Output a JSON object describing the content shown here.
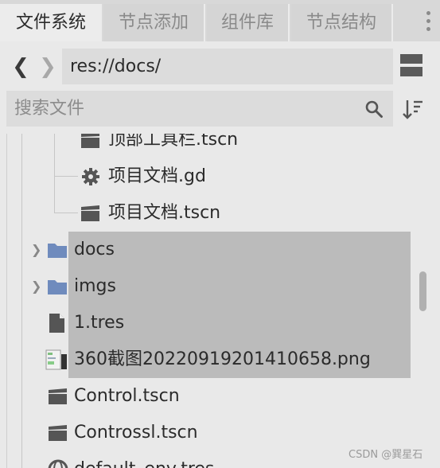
{
  "tabs": [
    {
      "label": "文件系统",
      "active": true
    },
    {
      "label": "节点添加",
      "active": false
    },
    {
      "label": "组件库",
      "active": false
    },
    {
      "label": "节点结构",
      "active": false
    }
  ],
  "nav": {
    "back": "❮",
    "forward": "❯"
  },
  "path": {
    "value": "res://docs/"
  },
  "search": {
    "placeholder": "搜索文件"
  },
  "tree": {
    "items": [
      {
        "label": "顶部工具栏.tscn",
        "icon": "scene-clapper-icon"
      },
      {
        "label": "项目文档.gd",
        "icon": "script-gear-icon"
      },
      {
        "label": "项目文档.tscn",
        "icon": "scene-clapper-icon"
      },
      {
        "label": "docs",
        "icon": "folder-icon",
        "selected": true
      },
      {
        "label": "imgs",
        "icon": "folder-icon",
        "selected": true
      },
      {
        "label": "1.tres",
        "icon": "resource-file-icon",
        "selected": true
      },
      {
        "label": "360截图20220919201410658.png",
        "icon": "image-thumbnail-icon",
        "selected": true
      },
      {
        "label": "Control.tscn",
        "icon": "scene-clapper-icon"
      },
      {
        "label": "Controssl.tscn",
        "icon": "scene-clapper-icon"
      },
      {
        "label": "default_env.tres",
        "icon": "environment-globe-icon"
      }
    ]
  },
  "watermark": "CSDN @巽星石",
  "colors": {
    "selection": "#bbbbbb",
    "folder": "#6f8bbd",
    "background": "#e9e9e9"
  }
}
